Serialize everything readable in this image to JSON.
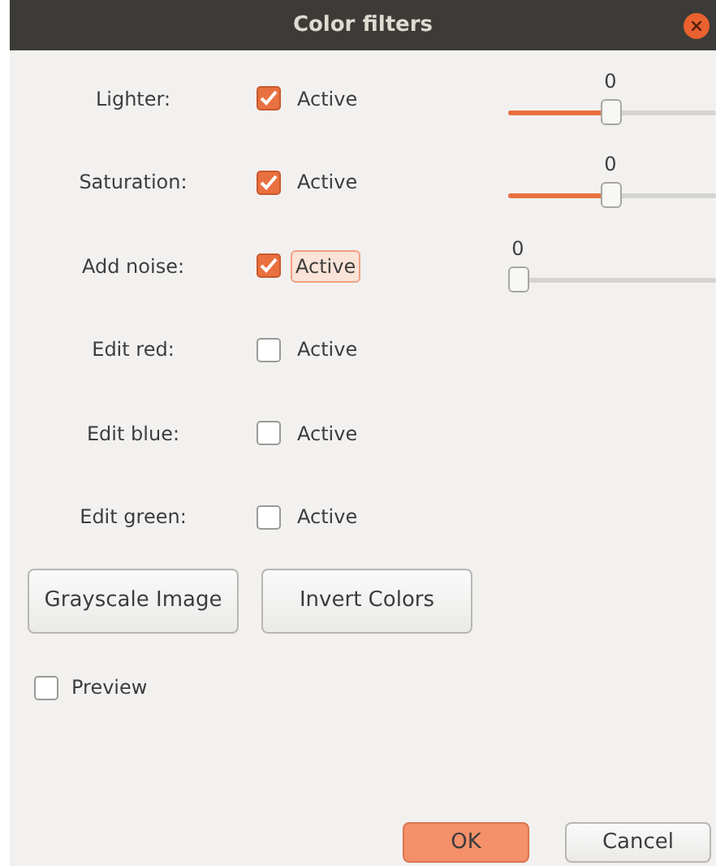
{
  "window": {
    "title": "Color filters"
  },
  "filters": [
    {
      "label": "Lighter:",
      "checkbox": "Active",
      "checked": true,
      "focused": false,
      "slider": {
        "value": "0",
        "level": 0.5
      }
    },
    {
      "label": "Saturation:",
      "checkbox": "Active",
      "checked": true,
      "focused": false,
      "slider": {
        "value": "0",
        "level": 0.5
      }
    },
    {
      "label": "Add noise:",
      "checkbox": "Active",
      "checked": true,
      "focused": true,
      "slider": {
        "value": "0",
        "level": 0
      }
    },
    {
      "label": "Edit red:",
      "checkbox": "Active",
      "checked": false,
      "focused": false
    },
    {
      "label": "Edit blue:",
      "checkbox": "Active",
      "checked": false,
      "focused": false
    },
    {
      "label": "Edit green:",
      "checkbox": "Active",
      "checked": false,
      "focused": false
    }
  ],
  "actions": [
    "Grayscale Image",
    "Invert Colors"
  ],
  "preview": {
    "label": "Preview",
    "checked": false
  },
  "buttons": [
    {
      "label": "OK",
      "kind": "primary"
    },
    {
      "label": "Cancel",
      "kind": "secondary"
    }
  ]
}
